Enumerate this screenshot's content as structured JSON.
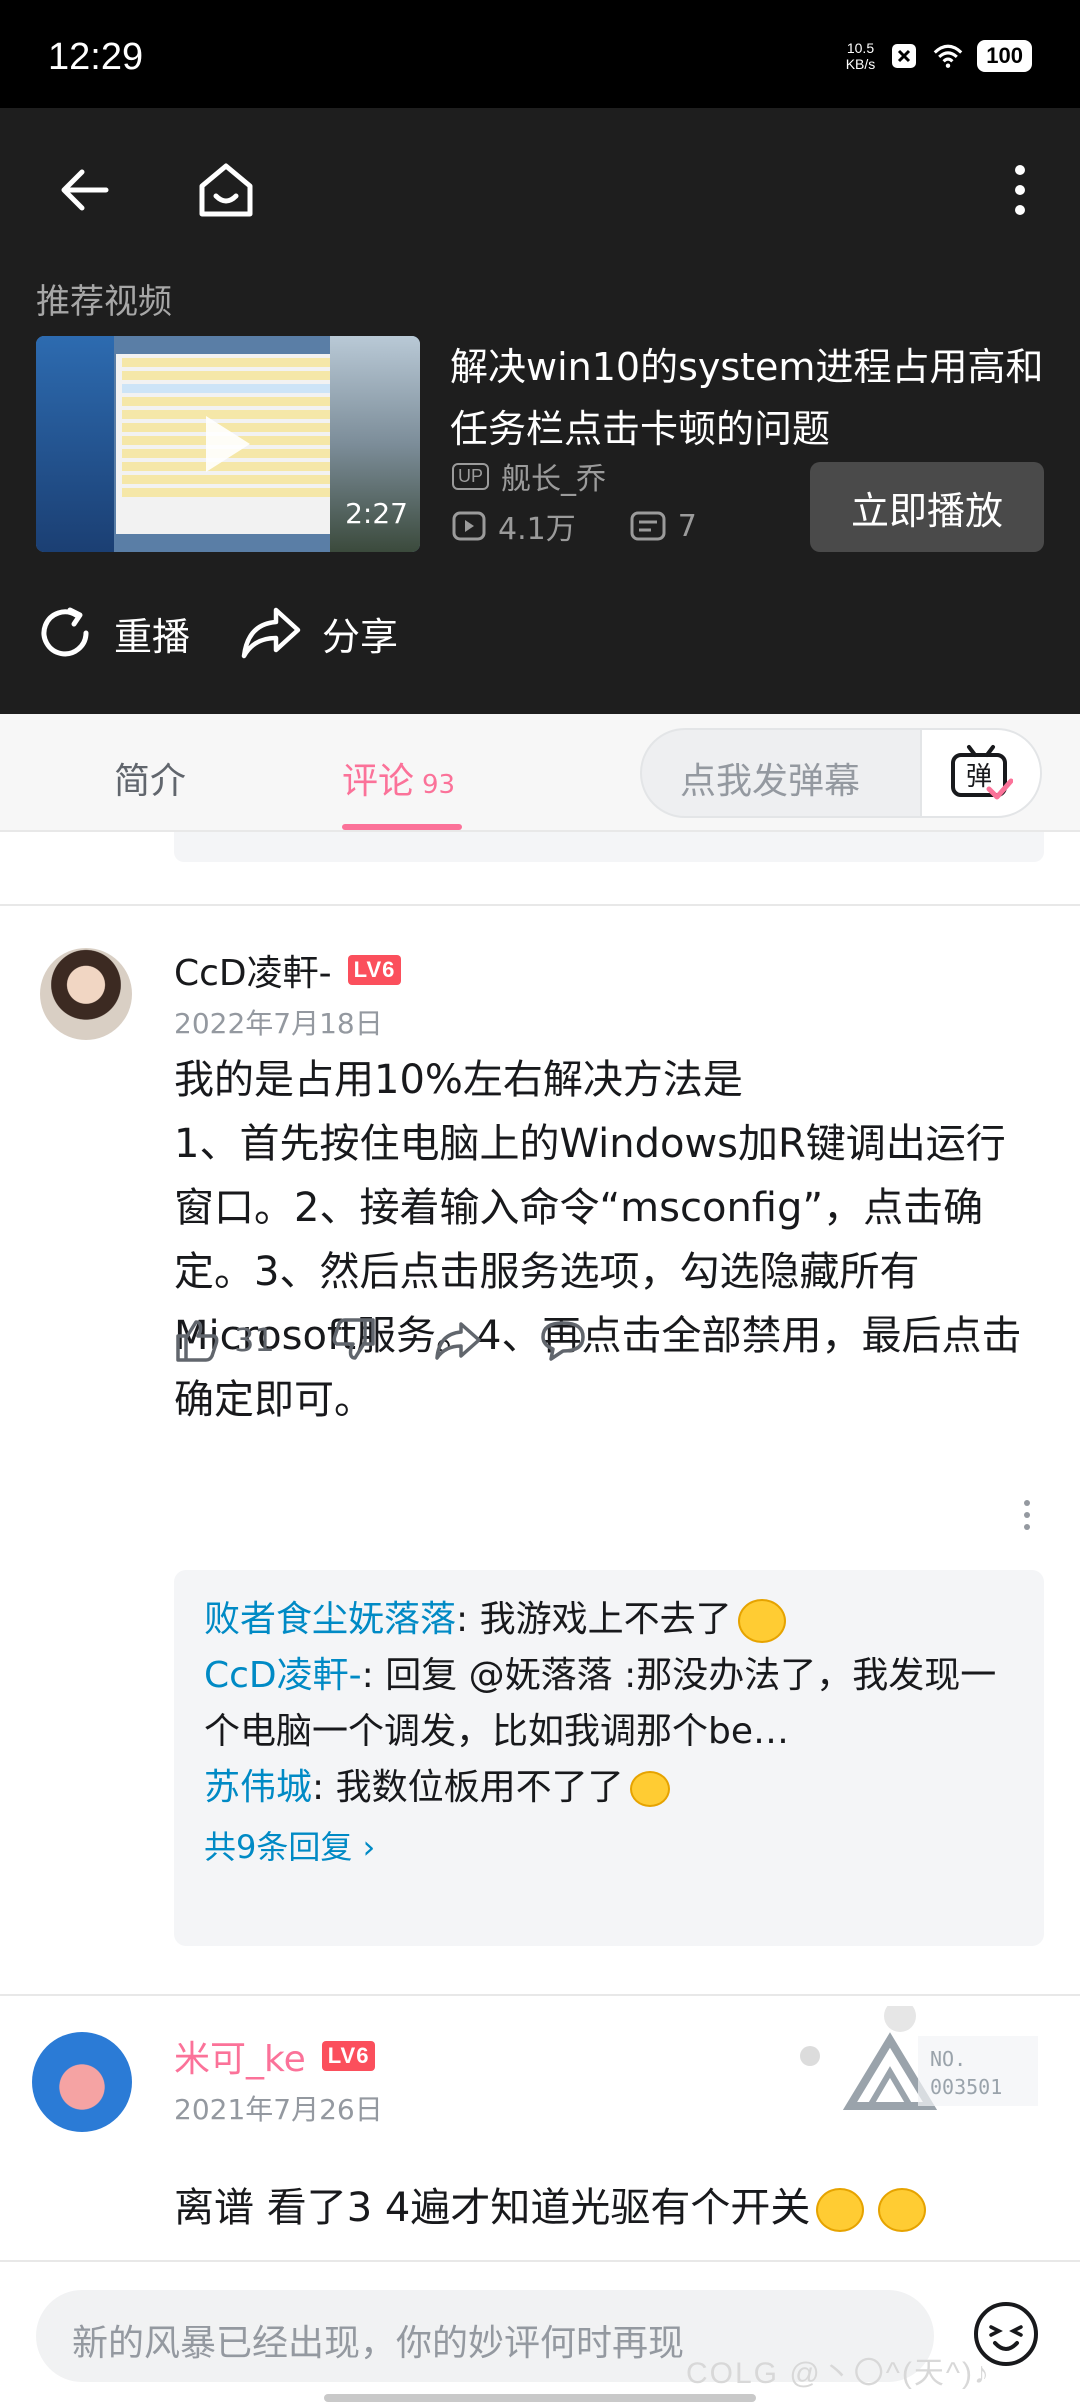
{
  "status_bar": {
    "time": "12:29",
    "net_speed_value": "10.5",
    "net_speed_unit": "KB/s",
    "battery": "100"
  },
  "header": {
    "recommended_label": "推荐视频",
    "video": {
      "title": "解决win10的system进程占用高和任务栏点击卡顿的问题",
      "duration": "2:27",
      "up_badge": "UP",
      "uploader": "舰长_乔",
      "views": "4.1万",
      "danmaku_count": "7"
    },
    "play_now_label": "立即播放",
    "replay_label": "重播",
    "share_label": "分享"
  },
  "tabs": {
    "intro": "简介",
    "comments": "评论",
    "comments_count": "93",
    "danmaku_placeholder": "点我发弹幕",
    "danmaku_btn": "弹"
  },
  "comments": [
    {
      "user": "CcD凌軒-",
      "level": "LV6",
      "date": "2022年7月18日",
      "text": "我的是占用10%左右解决方法是\n1、首先按住电脑上的Windows加R键调出运行窗口。2、接着输入命令“msconfig”，点击确定。3、然后点击服务选项，勾选隐藏所有Microsoft服务。4、再点击全部禁用，最后点击确定即可。",
      "likes": "31",
      "replies": [
        {
          "who": "败者食尘妩落落",
          "text": ": 我游戏上不去了"
        },
        {
          "who": "CcD凌軒-",
          "text": ": 回复 @妩落落 :那没办法了，我发现一个电脑一个调发，比如我调那个be…"
        },
        {
          "who": "苏伟城",
          "text": ": 我数位板用不了了"
        }
      ],
      "more_replies": "共9条回复 ›"
    },
    {
      "user": "米可_ke",
      "level": "LV6",
      "date": "2021年7月26日",
      "text": "离谱 看了3 4遍才知道光驱有个开关",
      "badge_no_label": "NO.",
      "badge_no_value": "003501"
    }
  ],
  "bottom": {
    "input_placeholder": "新的风暴已经出现，你的妙评何时再现",
    "watermark": "COLG @丶〇^(天^)♪"
  },
  "colors": {
    "accent_pink": "#fb7299",
    "link_blue": "#008ac5",
    "header_bg": "#1e1e1e"
  }
}
